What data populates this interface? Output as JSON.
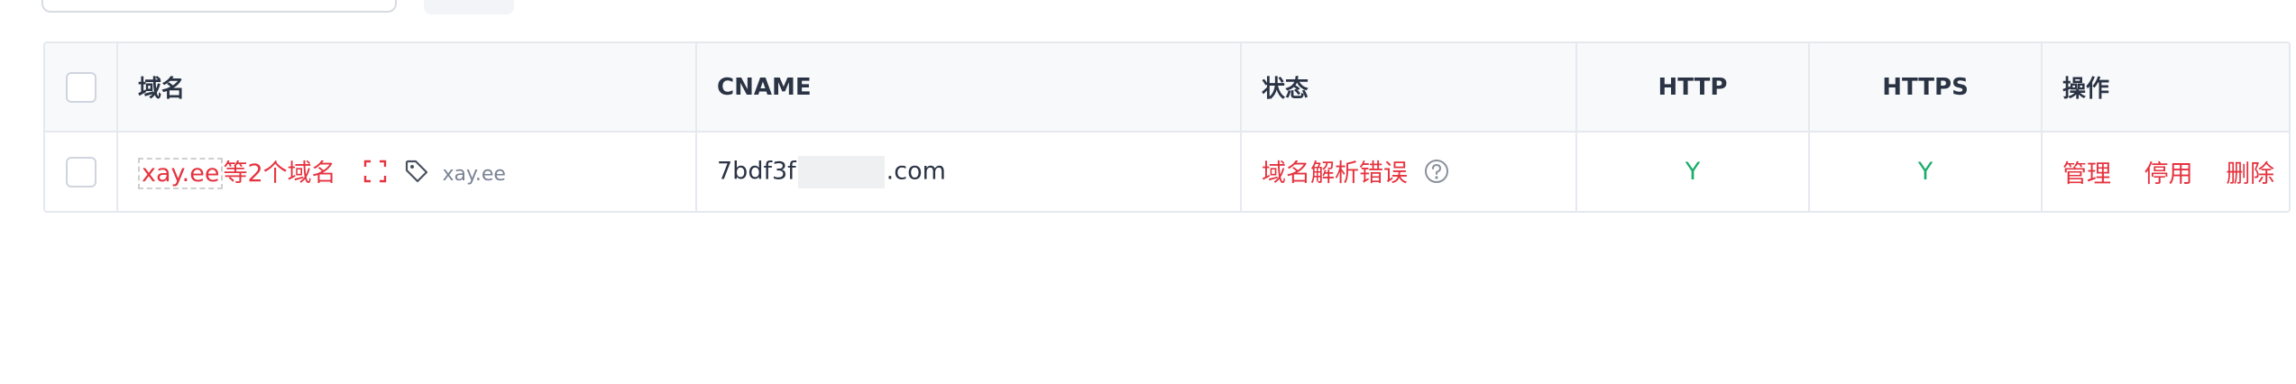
{
  "table": {
    "headers": {
      "domain": "域名",
      "cname": "CNAME",
      "status": "状态",
      "http": "HTTP",
      "https": "HTTPS",
      "actions": "操作"
    },
    "rows": [
      {
        "domain_primary": "xay.ee",
        "domain_more": "等2个域名",
        "tag": "xay.ee",
        "cname_prefix": "7bdf3f",
        "cname_suffix": ".com",
        "status": "域名解析错误",
        "http": "Y",
        "https": "Y",
        "actions": {
          "manage": "管理",
          "disable": "停用",
          "delete": "删除"
        }
      }
    ]
  },
  "icons": {
    "expand": "expand-icon",
    "tag": "tag-icon",
    "help": "question-circle-icon"
  },
  "colors": {
    "accent_red": "#e5333f",
    "success_green": "#1aad6b",
    "header_bg": "#f8f9fb",
    "border": "#e4e8ef"
  }
}
